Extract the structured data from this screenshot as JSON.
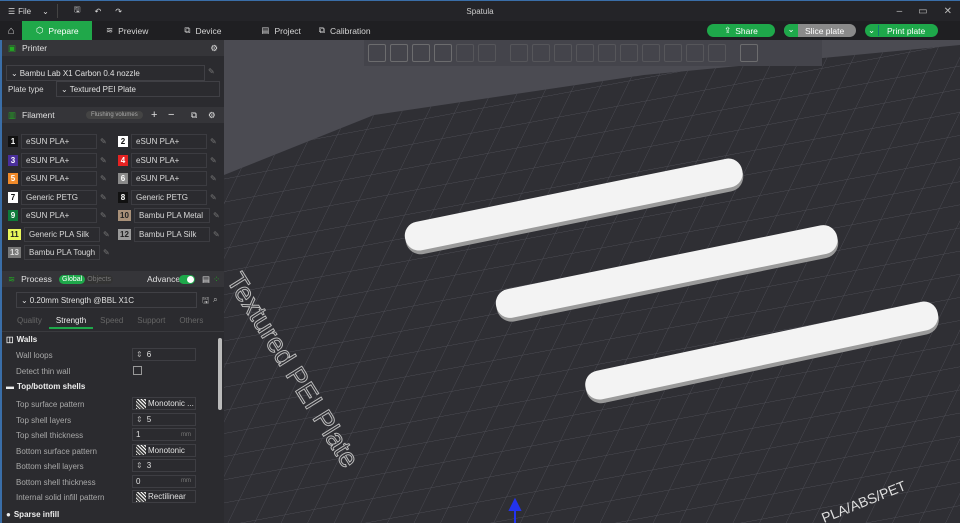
{
  "titlebar": {
    "file": "File",
    "title": "Spatula"
  },
  "tabs": [
    {
      "label": "Prepare"
    },
    {
      "label": "Preview"
    },
    {
      "label": "Device"
    },
    {
      "label": "Project"
    },
    {
      "label": "Calibration"
    }
  ],
  "actions": {
    "share": "Share",
    "slice": "Slice plate",
    "print": "Print plate"
  },
  "printer": {
    "header": "Printer",
    "name": "Bambu Lab X1 Carbon 0.4 nozzle",
    "plate_label": "Plate type",
    "plate": "Textured PEI Plate"
  },
  "filament": {
    "header": "Filament",
    "flushing": "Flushing volumes",
    "items": [
      {
        "n": "1",
        "name": "eSUN PLA+",
        "color": "#111111",
        "fg": "#ffffff"
      },
      {
        "n": "2",
        "name": "eSUN PLA+",
        "color": "#ffffff",
        "fg": "#111111"
      },
      {
        "n": "3",
        "name": "eSUN PLA+",
        "color": "#4a2f9a",
        "fg": "#ffffff"
      },
      {
        "n": "4",
        "name": "eSUN PLA+",
        "color": "#e52222",
        "fg": "#ffffff"
      },
      {
        "n": "5",
        "name": "eSUN PLA+",
        "color": "#f08a2a",
        "fg": "#ffffff"
      },
      {
        "n": "6",
        "name": "eSUN PLA+",
        "color": "#8a8a8a",
        "fg": "#ffffff"
      },
      {
        "n": "7",
        "name": "Generic PETG",
        "color": "#ffffff",
        "fg": "#111111"
      },
      {
        "n": "8",
        "name": "Generic PETG",
        "color": "#111111",
        "fg": "#ffffff"
      },
      {
        "n": "9",
        "name": "eSUN PLA+",
        "color": "#0e7a3a",
        "fg": "#ffffff"
      },
      {
        "n": "10",
        "name": "Bambu PLA Metal",
        "color": "#a89078",
        "fg": "#222222"
      },
      {
        "n": "11",
        "name": "Generic PLA Silk",
        "color": "#e8f55a",
        "fg": "#222222"
      },
      {
        "n": "12",
        "name": "Bambu PLA Silk",
        "color": "#9a9a9a",
        "fg": "#222222"
      },
      {
        "n": "13",
        "name": "Bambu PLA Tough",
        "color": "#777777",
        "fg": "#dddddd"
      }
    ]
  },
  "process": {
    "header": "Process",
    "global": "Global",
    "objects": "Objects",
    "advance": "Advance",
    "preset": "0.20mm Strength @BBL X1C",
    "subtabs": [
      "Quality",
      "Strength",
      "Speed",
      "Support",
      "Others"
    ],
    "walls": "Walls",
    "wall_loops_label": "Wall loops",
    "wall_loops": "6",
    "detect_thin": "Detect thin wall",
    "shells": "Top/bottom shells",
    "rows": [
      {
        "label": "Top surface pattern",
        "value": "Monotonic ...",
        "pattern": true
      },
      {
        "label": "Top shell layers",
        "value": "5",
        "spin": true
      },
      {
        "label": "Top shell thickness",
        "value": "1",
        "unit": "mm"
      },
      {
        "label": "Bottom surface pattern",
        "value": "Monotonic",
        "pattern": true
      },
      {
        "label": "Bottom shell layers",
        "value": "3",
        "spin": true
      },
      {
        "label": "Bottom shell thickness",
        "value": "0",
        "unit": "mm"
      },
      {
        "label": "Internal solid infill pattern",
        "value": "Rectilinear",
        "pattern": true
      }
    ],
    "sparse": "Sparse infill"
  },
  "viewport": {
    "plate_text": "Textured PEI Plate",
    "plate_badge": "PLA/ABS/PET"
  }
}
